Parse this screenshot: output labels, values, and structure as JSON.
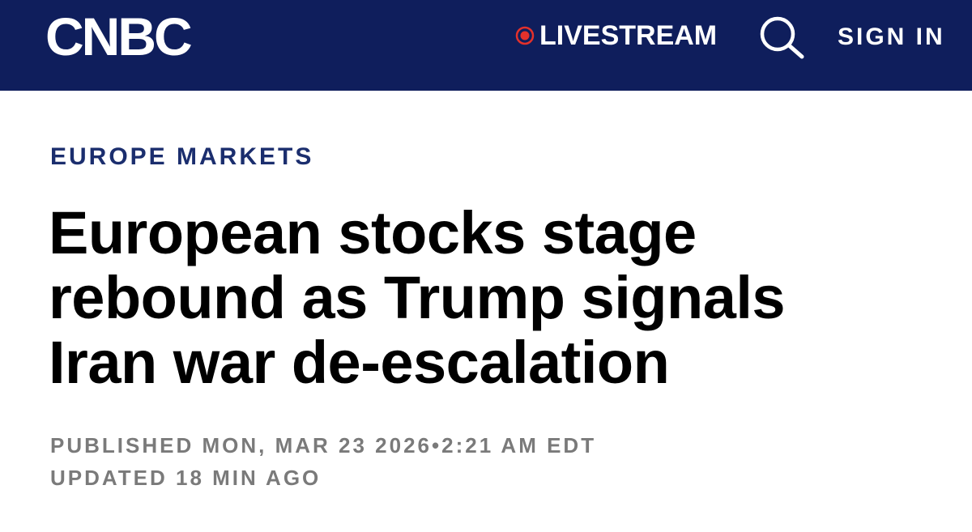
{
  "header": {
    "logo_text": "CNBC",
    "livestream_label": "LIVESTREAM",
    "signin_label": "SIGN IN",
    "search_icon": "search-icon",
    "live_icon": "live-record-dot-icon",
    "background_color": "#0f1e5c",
    "live_dot_color": "#e4312b"
  },
  "article": {
    "category": "EUROPE MARKETS",
    "headline_lines": [
      "European stocks stage",
      "rebound as Trump signals",
      "Iran war de-escalation"
    ],
    "published_label": "PUBLISHED",
    "published_date": "MON, MAR 23 2026",
    "separator": "•",
    "published_time": "2:21 AM EDT",
    "updated_label": "UPDATED",
    "updated_ago": "18 MIN AGO",
    "category_color": "#1b2e6e",
    "meta_color": "#7a7a7a"
  }
}
